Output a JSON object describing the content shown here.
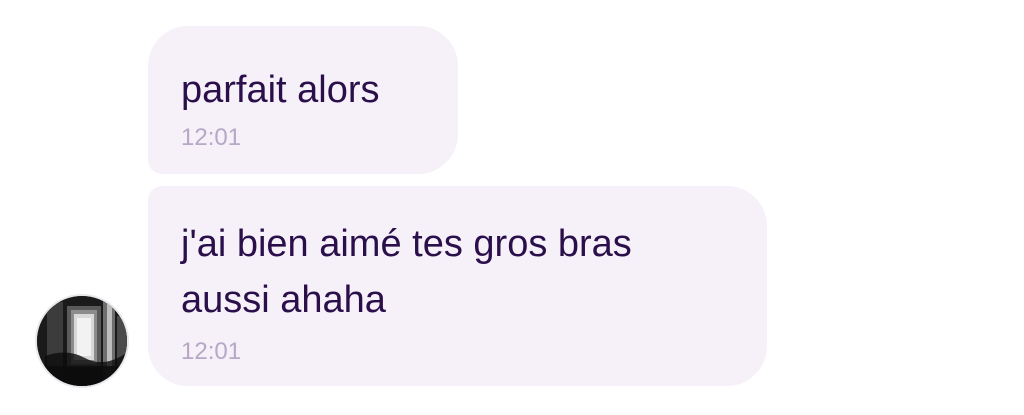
{
  "messages": [
    {
      "text_lines": [
        "parfait alors"
      ],
      "time": "12:01"
    },
    {
      "text_lines": [
        "j'ai bien aimé tes gros bras",
        "aussi ahaha"
      ],
      "time": "12:01"
    }
  ],
  "colors": {
    "bubble": "#f6f0f9",
    "message_text": "#2a0f4a",
    "timestamp": "#b7a8c6"
  },
  "avatar": {
    "icon": "contact-photo-icon"
  }
}
